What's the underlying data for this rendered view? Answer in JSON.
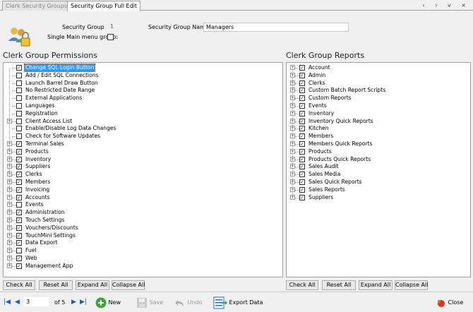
{
  "tabs": [
    {
      "label": "Clerk Security Groups",
      "active": false
    },
    {
      "label": "Security Group Full Edit",
      "active": true
    }
  ],
  "window_controls": "‹ › v ×",
  "header": {
    "security_group_id_label": "Security Group ID:",
    "security_group_id_value": "1",
    "single_main_menu_label": "Single Main menu group:",
    "security_group_name_label": "Security Group Name:",
    "security_group_name_value": "Managers"
  },
  "permissions": {
    "title": "Clerk Group Permissions",
    "items": [
      {
        "label": "Change SQL Login Button",
        "checked": true,
        "expandable": false,
        "selected": true
      },
      {
        "label": "Add / Edit SQL Connections",
        "checked": false,
        "expandable": false
      },
      {
        "label": "Launch Barrel Draw Button",
        "checked": false,
        "expandable": false
      },
      {
        "label": "No Restricted Date Range",
        "checked": false,
        "expandable": false
      },
      {
        "label": "External Applications",
        "checked": false,
        "expandable": false
      },
      {
        "label": "Languages",
        "checked": false,
        "expandable": false
      },
      {
        "label": "Registration",
        "checked": false,
        "expandable": false
      },
      {
        "label": "Client Access List",
        "checked": false,
        "expandable": true
      },
      {
        "label": "Enable/Disable Log Data Changes",
        "checked": false,
        "expandable": false
      },
      {
        "label": "Check for Software Updates",
        "checked": false,
        "expandable": false
      },
      {
        "label": "Terminal Sales",
        "checked": true,
        "expandable": true
      },
      {
        "label": "Products",
        "checked": true,
        "expandable": true
      },
      {
        "label": "Inventory",
        "checked": true,
        "expandable": true
      },
      {
        "label": "Suppliers",
        "checked": true,
        "expandable": true
      },
      {
        "label": "Clerks",
        "checked": true,
        "expandable": true
      },
      {
        "label": "Members",
        "checked": true,
        "expandable": true
      },
      {
        "label": "Invoicing",
        "checked": true,
        "expandable": true
      },
      {
        "label": "Accounts",
        "checked": true,
        "expandable": true
      },
      {
        "label": "Events",
        "checked": false,
        "expandable": true
      },
      {
        "label": "Administration",
        "checked": true,
        "expandable": true
      },
      {
        "label": "Touch Settings",
        "checked": true,
        "expandable": true
      },
      {
        "label": "Vouchers/Discounts",
        "checked": true,
        "expandable": true
      },
      {
        "label": "TouchMini Settings",
        "checked": true,
        "expandable": true
      },
      {
        "label": "Data Export",
        "checked": true,
        "expandable": true
      },
      {
        "label": "Fuel",
        "checked": false,
        "expandable": true
      },
      {
        "label": "Web",
        "checked": true,
        "expandable": true
      },
      {
        "label": "Management App",
        "checked": true,
        "expandable": true
      }
    ],
    "buttons": {
      "check_all": "Check All",
      "reset_all": "Reset All",
      "expand_all": "Expand All",
      "collapse_all": "Collapse All"
    }
  },
  "reports": {
    "title": "Clerk Group Reports",
    "items": [
      {
        "label": "Account",
        "checked": true
      },
      {
        "label": "Admin",
        "checked": true
      },
      {
        "label": "Clerks",
        "checked": true
      },
      {
        "label": "Custom Batch Report Scripts",
        "checked": true
      },
      {
        "label": "Custom Reports",
        "checked": true
      },
      {
        "label": "Events",
        "checked": true
      },
      {
        "label": "Inventory",
        "checked": true
      },
      {
        "label": "Inventory Quick Reports",
        "checked": true
      },
      {
        "label": "Kitchen",
        "checked": true
      },
      {
        "label": "Members",
        "checked": true
      },
      {
        "label": "Members Quick Reports",
        "checked": true
      },
      {
        "label": "Products",
        "checked": true
      },
      {
        "label": "Products Quick Reports",
        "checked": true
      },
      {
        "label": "Sales Audit",
        "checked": true
      },
      {
        "label": "Sales Media",
        "checked": true
      },
      {
        "label": "Sales Quick Reports",
        "checked": true
      },
      {
        "label": "Sales Reports",
        "checked": true
      },
      {
        "label": "Suppliers",
        "checked": true
      }
    ],
    "buttons": {
      "check_all": "Check All",
      "reset_all": "Reset All",
      "expand_all": "Expand All",
      "collapse_all": "Collapse All"
    }
  },
  "footer": {
    "current_page": "3",
    "of_pages": "of 5",
    "new_label": "New",
    "save_label": "Save",
    "undo_label": "Undo",
    "export_label": "Export Data",
    "close_label": "Close"
  },
  "colors": {
    "selection": "#3399ff",
    "nav_blue": "#1a5fb4",
    "new_green": "#3aa53a",
    "close_red": "#d23a2a"
  }
}
